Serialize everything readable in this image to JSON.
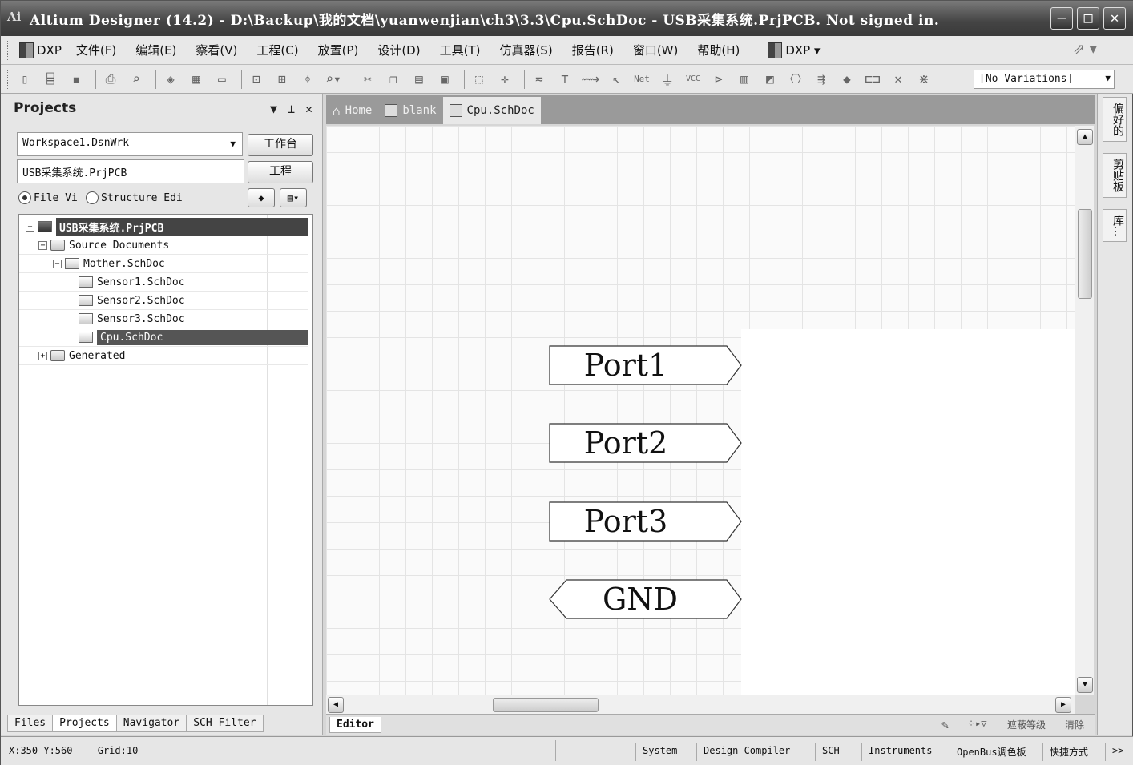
{
  "window": {
    "app_icon": "Ai",
    "title": "Altium Designer (14.2) - D:\\Backup\\我的文档\\yuanwenjian\\ch3\\3.3\\Cpu.SchDoc - USB采集系统.PrjPCB. Not signed in.",
    "minimize": "–",
    "maximize": "□",
    "close": "✕"
  },
  "menubar": {
    "dxp_label": "DXP",
    "items": [
      "文件(F)",
      "编辑(E)",
      "察看(V)",
      "工程(C)",
      "放置(P)",
      "设计(D)",
      "工具(T)",
      "仿真器(S)",
      "报告(R)",
      "窗口(W)",
      "帮助(H)"
    ],
    "dxp_menu_label": "DXP ▾"
  },
  "toolbar": {
    "variations": "[No Variations]",
    "net_label": "Net",
    "vcc_label": "VCC"
  },
  "projects_panel": {
    "title": "Projects",
    "workspace_combo": "Workspace1.DsnWrk",
    "workspace_button": "工作台",
    "project_field": "USB采集系统.PrjPCB",
    "project_button": "工程",
    "radio_file_view": "File Vi",
    "radio_structure": "Structure Edi",
    "tree": [
      {
        "label": "USB采集系统.PrjPCB",
        "level": 0,
        "expander": "−",
        "type": "project",
        "selected": true
      },
      {
        "label": "Source Documents",
        "level": 1,
        "expander": "−",
        "type": "folder",
        "selected": false
      },
      {
        "label": "Mother.SchDoc",
        "level": 2,
        "expander": "−",
        "type": "doc",
        "selected": false
      },
      {
        "label": "Sensor1.SchDoc",
        "level": 3,
        "expander": "",
        "type": "doc",
        "selected": false
      },
      {
        "label": "Sensor2.SchDoc",
        "level": 3,
        "expander": "",
        "type": "doc",
        "selected": false
      },
      {
        "label": "Sensor3.SchDoc",
        "level": 3,
        "expander": "",
        "type": "doc",
        "selected": false
      },
      {
        "label": "Cpu.SchDoc",
        "level": 3,
        "expander": "",
        "type": "doc",
        "selected": true
      },
      {
        "label": "Generated",
        "level": 1,
        "expander": "+",
        "type": "folder",
        "selected": false
      }
    ],
    "bottom_tabs": [
      "Files",
      "Projects",
      "Navigator",
      "SCH Filter"
    ]
  },
  "doc_tabs": [
    "Home",
    "blank",
    "Cpu.SchDoc"
  ],
  "schematic": {
    "ports": [
      "Port1",
      "Port2",
      "Port3",
      "GND"
    ]
  },
  "editor_bar": {
    "tab": "Editor",
    "mask_level": "遮蔽等级",
    "clear": "清除"
  },
  "right_panel": {
    "tabs": [
      "偏好的",
      "剪贴板",
      "库..."
    ]
  },
  "status_bar": {
    "coords": "X:350 Y:560",
    "grid": "Grid:10",
    "buttons": [
      "System",
      "Design Compiler",
      "SCH",
      "Instruments",
      "OpenBus调色板",
      "快捷方式"
    ],
    "more": ">>"
  }
}
